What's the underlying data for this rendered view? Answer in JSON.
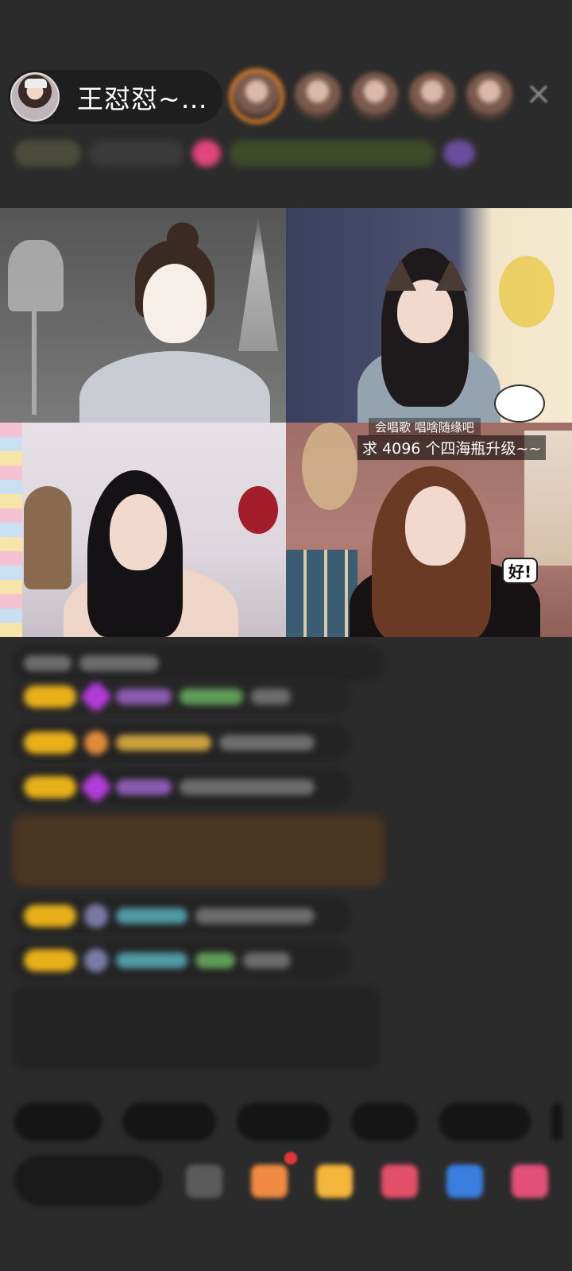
{
  "header": {
    "host_name": "王怼怼~…",
    "close_symbol": "×"
  },
  "video": {
    "overlay_song": "会唱歌   唱啥随缘吧",
    "overlay_request": "求 4096 个四海瓶升级~~",
    "sticker_text": "好!"
  },
  "colors": {
    "background": "#2b2b2b",
    "badge_gold": "#e8b019",
    "gem_purple": "#b13bd6",
    "notification_red": "#e23636"
  }
}
